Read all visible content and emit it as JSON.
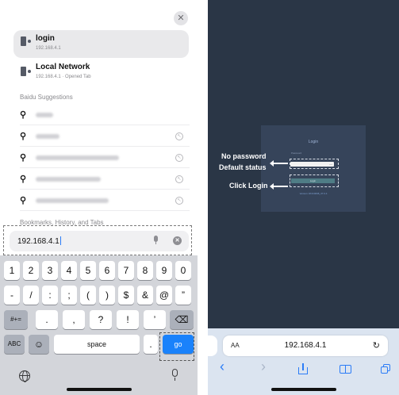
{
  "left": {
    "suggestions": [
      {
        "title": "login",
        "subtitle": "192.168.4.1"
      },
      {
        "title": "Local Network",
        "subtitle": "192.168.4.1 · Opened Tab"
      }
    ],
    "baidu_label": "Baidu Suggestions",
    "bookmarks_label": "Bookmarks, History, and Tabs",
    "address_value": "192.168.4.1",
    "keyboard": {
      "row1": [
        "1",
        "2",
        "3",
        "4",
        "5",
        "6",
        "7",
        "8",
        "9",
        "0"
      ],
      "row2": [
        "-",
        "/",
        ":",
        ";",
        "(",
        ")",
        "$",
        "&",
        "@",
        "”"
      ],
      "row3": [
        "#+=",
        ".",
        ",",
        "?",
        "!",
        "’",
        "⌫"
      ],
      "row4": [
        "ABC",
        "☺",
        "space",
        ".",
        "go"
      ]
    }
  },
  "right": {
    "login_title": "Login",
    "password_label": "Password",
    "login_button": "Login",
    "version": "Version: RNC0098_37.0.4",
    "annotations": {
      "no_password": "No password",
      "default_status": "Default status",
      "click_login": "Click Login"
    },
    "aa_label": "AA",
    "url": "192.168.4.1",
    "reload": "↻",
    "back": "‹",
    "forward": "›"
  },
  "icons": {
    "close": "✕",
    "search": "🔍",
    "clear": "✕",
    "fill_arrow": "↖",
    "eye": "—"
  },
  "colors": {
    "go_key": "#1a82fb",
    "dark_bg": "#2a3646",
    "panel": "#36445a",
    "login_button": "#4f7d86"
  }
}
